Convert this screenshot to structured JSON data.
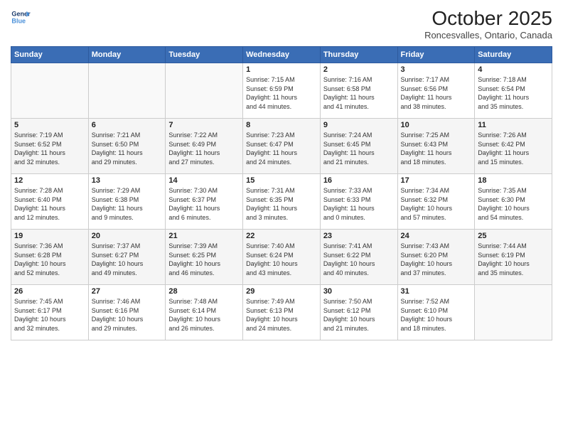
{
  "header": {
    "logo_line1": "General",
    "logo_line2": "Blue",
    "title": "October 2025",
    "subtitle": "Roncesvalles, Ontario, Canada"
  },
  "days_of_week": [
    "Sunday",
    "Monday",
    "Tuesday",
    "Wednesday",
    "Thursday",
    "Friday",
    "Saturday"
  ],
  "weeks": [
    [
      {
        "day": "",
        "info": ""
      },
      {
        "day": "",
        "info": ""
      },
      {
        "day": "",
        "info": ""
      },
      {
        "day": "1",
        "info": "Sunrise: 7:15 AM\nSunset: 6:59 PM\nDaylight: 11 hours\nand 44 minutes."
      },
      {
        "day": "2",
        "info": "Sunrise: 7:16 AM\nSunset: 6:58 PM\nDaylight: 11 hours\nand 41 minutes."
      },
      {
        "day": "3",
        "info": "Sunrise: 7:17 AM\nSunset: 6:56 PM\nDaylight: 11 hours\nand 38 minutes."
      },
      {
        "day": "4",
        "info": "Sunrise: 7:18 AM\nSunset: 6:54 PM\nDaylight: 11 hours\nand 35 minutes."
      }
    ],
    [
      {
        "day": "5",
        "info": "Sunrise: 7:19 AM\nSunset: 6:52 PM\nDaylight: 11 hours\nand 32 minutes."
      },
      {
        "day": "6",
        "info": "Sunrise: 7:21 AM\nSunset: 6:50 PM\nDaylight: 11 hours\nand 29 minutes."
      },
      {
        "day": "7",
        "info": "Sunrise: 7:22 AM\nSunset: 6:49 PM\nDaylight: 11 hours\nand 27 minutes."
      },
      {
        "day": "8",
        "info": "Sunrise: 7:23 AM\nSunset: 6:47 PM\nDaylight: 11 hours\nand 24 minutes."
      },
      {
        "day": "9",
        "info": "Sunrise: 7:24 AM\nSunset: 6:45 PM\nDaylight: 11 hours\nand 21 minutes."
      },
      {
        "day": "10",
        "info": "Sunrise: 7:25 AM\nSunset: 6:43 PM\nDaylight: 11 hours\nand 18 minutes."
      },
      {
        "day": "11",
        "info": "Sunrise: 7:26 AM\nSunset: 6:42 PM\nDaylight: 11 hours\nand 15 minutes."
      }
    ],
    [
      {
        "day": "12",
        "info": "Sunrise: 7:28 AM\nSunset: 6:40 PM\nDaylight: 11 hours\nand 12 minutes."
      },
      {
        "day": "13",
        "info": "Sunrise: 7:29 AM\nSunset: 6:38 PM\nDaylight: 11 hours\nand 9 minutes."
      },
      {
        "day": "14",
        "info": "Sunrise: 7:30 AM\nSunset: 6:37 PM\nDaylight: 11 hours\nand 6 minutes."
      },
      {
        "day": "15",
        "info": "Sunrise: 7:31 AM\nSunset: 6:35 PM\nDaylight: 11 hours\nand 3 minutes."
      },
      {
        "day": "16",
        "info": "Sunrise: 7:33 AM\nSunset: 6:33 PM\nDaylight: 11 hours\nand 0 minutes."
      },
      {
        "day": "17",
        "info": "Sunrise: 7:34 AM\nSunset: 6:32 PM\nDaylight: 10 hours\nand 57 minutes."
      },
      {
        "day": "18",
        "info": "Sunrise: 7:35 AM\nSunset: 6:30 PM\nDaylight: 10 hours\nand 54 minutes."
      }
    ],
    [
      {
        "day": "19",
        "info": "Sunrise: 7:36 AM\nSunset: 6:28 PM\nDaylight: 10 hours\nand 52 minutes."
      },
      {
        "day": "20",
        "info": "Sunrise: 7:37 AM\nSunset: 6:27 PM\nDaylight: 10 hours\nand 49 minutes."
      },
      {
        "day": "21",
        "info": "Sunrise: 7:39 AM\nSunset: 6:25 PM\nDaylight: 10 hours\nand 46 minutes."
      },
      {
        "day": "22",
        "info": "Sunrise: 7:40 AM\nSunset: 6:24 PM\nDaylight: 10 hours\nand 43 minutes."
      },
      {
        "day": "23",
        "info": "Sunrise: 7:41 AM\nSunset: 6:22 PM\nDaylight: 10 hours\nand 40 minutes."
      },
      {
        "day": "24",
        "info": "Sunrise: 7:43 AM\nSunset: 6:20 PM\nDaylight: 10 hours\nand 37 minutes."
      },
      {
        "day": "25",
        "info": "Sunrise: 7:44 AM\nSunset: 6:19 PM\nDaylight: 10 hours\nand 35 minutes."
      }
    ],
    [
      {
        "day": "26",
        "info": "Sunrise: 7:45 AM\nSunset: 6:17 PM\nDaylight: 10 hours\nand 32 minutes."
      },
      {
        "day": "27",
        "info": "Sunrise: 7:46 AM\nSunset: 6:16 PM\nDaylight: 10 hours\nand 29 minutes."
      },
      {
        "day": "28",
        "info": "Sunrise: 7:48 AM\nSunset: 6:14 PM\nDaylight: 10 hours\nand 26 minutes."
      },
      {
        "day": "29",
        "info": "Sunrise: 7:49 AM\nSunset: 6:13 PM\nDaylight: 10 hours\nand 24 minutes."
      },
      {
        "day": "30",
        "info": "Sunrise: 7:50 AM\nSunset: 6:12 PM\nDaylight: 10 hours\nand 21 minutes."
      },
      {
        "day": "31",
        "info": "Sunrise: 7:52 AM\nSunset: 6:10 PM\nDaylight: 10 hours\nand 18 minutes."
      },
      {
        "day": "",
        "info": ""
      }
    ]
  ]
}
